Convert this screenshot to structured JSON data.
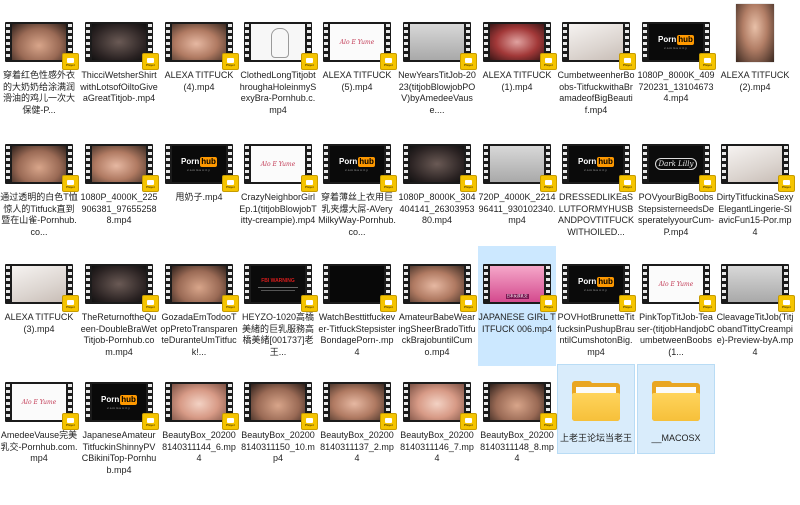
{
  "files": [
    {
      "id": "r1c1",
      "name": "穿着红色性感外衣的大奶奶给涂满润滑油的鸡儿一次大保健-P...",
      "thumb": "video",
      "style": "skin",
      "selected": false
    },
    {
      "id": "r1c2",
      "name": "ThicciWetsherShirtwithLotsofOiltoGiveaGreatTitjob-.mp4",
      "thumb": "video",
      "style": "dark",
      "selected": false
    },
    {
      "id": "r1c3",
      "name": "ALEXA TITFUCK (4).mp4",
      "thumb": "video",
      "style": "skin2",
      "selected": false
    },
    {
      "id": "r1c4",
      "name": "ClothedLongTitjobthroughaHoleinmySexyBra-Pornhub.c.mp4",
      "thumb": "video",
      "style": "sketch",
      "selected": false
    },
    {
      "id": "r1c5",
      "name": "ALEXA TITFUCK (5).mp4",
      "thumb": "video",
      "style": "signature",
      "selected": false
    },
    {
      "id": "r1c6",
      "name": "NewYearsTitJob-2023(titjobBlowjobPOV)byAmedeeVause....",
      "thumb": "video",
      "style": "grey",
      "selected": false
    },
    {
      "id": "r1c7",
      "name": "ALEXA TITFUCK (1).mp4",
      "thumb": "video",
      "style": "red",
      "selected": false
    },
    {
      "id": "r1c8",
      "name": "CumbetweenherBoobs-TitfuckwithaBramadeofBigBeautif.mp4",
      "thumb": "video",
      "style": "light",
      "selected": false
    },
    {
      "id": "r1c9",
      "name": "1080P_8000K_409720231_131046734.mp4",
      "thumb": "video",
      "style": "pornhub",
      "selected": false
    },
    {
      "id": "r1c10",
      "name": "ALEXA TITFUCK (2).mp4",
      "thumb": "photo",
      "style": "photo",
      "selected": false
    },
    {
      "id": "r2c1",
      "name": "通过透明的白色T恤惊人的Titfuck直到暨在山雀-Pornhub.co...",
      "thumb": "video",
      "style": "skin",
      "selected": false
    },
    {
      "id": "r2c2",
      "name": "1080P_4000K_225906381_976552588.mp4",
      "thumb": "video",
      "style": "skin2",
      "selected": false
    },
    {
      "id": "r2c3",
      "name": "甩奶子.mp4",
      "thumb": "video",
      "style": "pornhub",
      "selected": false
    },
    {
      "id": "r2c4",
      "name": "CrazyNeighborGirlEp.1(titjobBlowjobTitty-creampie).mp4",
      "thumb": "video",
      "style": "signature",
      "selected": false
    },
    {
      "id": "r2c5",
      "name": "穿着薄丝上衣用巨乳夹爆大屌-AVeryMilkyWay-Pornhub.co...",
      "thumb": "video",
      "style": "pornhub",
      "selected": false
    },
    {
      "id": "r2c6",
      "name": "1080P_8000K_304404141_2630395380.mp4",
      "thumb": "video",
      "style": "dark",
      "selected": false
    },
    {
      "id": "r2c7",
      "name": "720P_4000K_221496411_930102340.mp4",
      "thumb": "video",
      "style": "grey",
      "selected": false
    },
    {
      "id": "r2c8",
      "name": "DRESSEDLIKEaSLUTFORMYHUSBANDPOVTITFUCKWITHOILED...",
      "thumb": "video",
      "style": "pornhub",
      "selected": false
    },
    {
      "id": "r2c9",
      "name": "POVyourBigBoobsStepsisterneedsDesperatelyyourCum-P.mp4",
      "thumb": "video",
      "style": "darklilly",
      "selected": false
    },
    {
      "id": "r2c10",
      "name": "DirtyTitfuckinaSexyElegantLingerie-SlavicFun15-Por.mp4",
      "thumb": "video",
      "style": "light",
      "selected": false
    },
    {
      "id": "r3c1",
      "name": "ALEXA TITFUCK (3).mp4",
      "thumb": "video",
      "style": "light",
      "selected": false
    },
    {
      "id": "r3c2",
      "name": "TheReturnoftheQueen-DoubleBraWetTitjob-Pornhub.com.mp4",
      "thumb": "video",
      "style": "dark",
      "selected": false
    },
    {
      "id": "r3c3",
      "name": "GozadaEmTodooTopPretoTransparenteDuranteUmTitfuck!...",
      "thumb": "video",
      "style": "skin",
      "selected": false
    },
    {
      "id": "r3c4",
      "name": "HEYZO-1020高橋美緒的巨乳服務高橋美緒[001737]老王...",
      "thumb": "video",
      "style": "fbi",
      "selected": false
    },
    {
      "id": "r3c5",
      "name": "WatchBesttitfuckever-TitfuckStepsisterBondagePorn-.mp4",
      "thumb": "video",
      "style": "black",
      "selected": false
    },
    {
      "id": "r3c6",
      "name": "AmateurBabeWearingSheerBradoTitfuckBrajobuntilCumo.mp4",
      "thumb": "video",
      "style": "skin2",
      "selected": false
    },
    {
      "id": "r3c7",
      "name": "JAPANESE GIRL TITFUCK 006.mp4",
      "thumb": "video",
      "style": "jp",
      "selected": true
    },
    {
      "id": "r3c8",
      "name": "POVHotBrunetteTitfucksinPushupBrauntilCumshotonBig.mp4",
      "thumb": "video",
      "style": "pornhub",
      "selected": false
    },
    {
      "id": "r3c9",
      "name": "PinkTopTitJob-Teaser-(titjobHandjobCumbetweenBoobs(1...",
      "thumb": "video",
      "style": "signature",
      "selected": false
    },
    {
      "id": "r3c10",
      "name": "CleavageTitJob(TitjobandTittyCreampie)-Preview-byA.mp4",
      "thumb": "video",
      "style": "grey",
      "selected": false
    },
    {
      "id": "r4c1",
      "name": "AmedeeVause完美乳交-Pornhub.com.mp4",
      "thumb": "video",
      "style": "signature",
      "selected": false
    },
    {
      "id": "r4c2",
      "name": "JapaneseAmateurTitfuckinShinnyPVCBikiniTop-Pornhub.mp4",
      "thumb": "video",
      "style": "pornhub",
      "selected": false
    },
    {
      "id": "r4c3",
      "name": "BeautyBox_202008140311144_6.mp4",
      "thumb": "video",
      "style": "bright",
      "selected": false
    },
    {
      "id": "r4c4",
      "name": "BeautyBox_202008140311150_10.mp4",
      "thumb": "video",
      "style": "skin",
      "selected": false
    },
    {
      "id": "r4c5",
      "name": "BeautyBox_202008140311137_2.mp4",
      "thumb": "video",
      "style": "skin2",
      "selected": false
    },
    {
      "id": "r4c6",
      "name": "BeautyBox_202008140311146_7.mp4",
      "thumb": "video",
      "style": "bright",
      "selected": false
    },
    {
      "id": "r4c7",
      "name": "BeautyBox_202008140311148_8.mp4",
      "thumb": "video",
      "style": "skin",
      "selected": false
    },
    {
      "id": "r4c8",
      "name": "上老王论坛当老王",
      "thumb": "folder",
      "style": "folder",
      "selected": true
    },
    {
      "id": "r4c9",
      "name": "__MACOSX",
      "thumb": "folder",
      "style": "folder",
      "selected": true
    }
  ],
  "thumb_text": {
    "pornhub_word": "Porn",
    "pornhub_box": "hub",
    "pornhub_sub": "community",
    "signature": "Alo E Yume",
    "dark_lilly": "Dark Lilly",
    "fbi_warning": "FBI WARNING",
    "jp_caption": "日本女孩乳交",
    "badge": "Player"
  },
  "colors": {
    "selection": "#cce8ff",
    "folder": "#f6c03a",
    "badge": "#f5c400"
  },
  "icons": {
    "video_badge": "media-player-badge-icon",
    "folder": "folder-icon"
  }
}
